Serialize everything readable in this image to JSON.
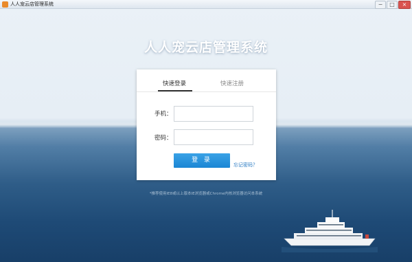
{
  "window": {
    "title": "人人宠云店管理系统",
    "controls": {
      "minimize": "−",
      "maximize": "□",
      "close": "×"
    }
  },
  "page": {
    "heading": "人人宠云店管理系统"
  },
  "login_card": {
    "tabs": [
      {
        "label": "快速登录",
        "active": true
      },
      {
        "label": "快速注册",
        "active": false
      }
    ],
    "phone_label": "手机：",
    "phone_value": "",
    "password_label": "密码：",
    "password_value": "",
    "login_button": "登 录",
    "forgot_link": "忘记密码？"
  },
  "hint": "*推荐使用IE8或以上版本IE浏览器或Chrome内核浏览器访问本系统",
  "colors": {
    "accent": "#1b86d4",
    "link": "#2c7cc4",
    "app_icon": "#e98a2b"
  },
  "icons": [
    "app-icon",
    "minimize-icon",
    "maximize-icon",
    "close-icon"
  ]
}
